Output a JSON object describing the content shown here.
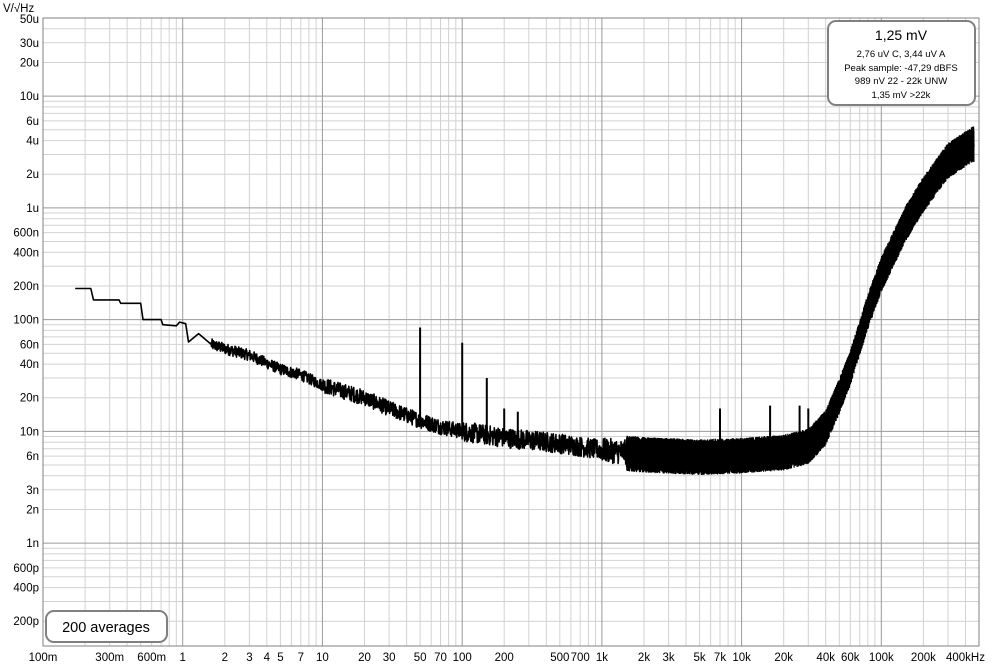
{
  "chart_data": {
    "type": "line",
    "y_unit_label": "V/√Hz",
    "x_scale": "log",
    "y_scale": "log",
    "xlim": [
      0.1,
      500000
    ],
    "ylim": [
      1.2e-10,
      5e-05
    ],
    "grid": true,
    "x_ticks": [
      {
        "v": 0.1,
        "l": "100m"
      },
      {
        "v": 0.3,
        "l": "300m"
      },
      {
        "v": 0.6,
        "l": "600m"
      },
      {
        "v": 1,
        "l": "1"
      },
      {
        "v": 2,
        "l": "2"
      },
      {
        "v": 3,
        "l": "3"
      },
      {
        "v": 4,
        "l": "4"
      },
      {
        "v": 5,
        "l": "5"
      },
      {
        "v": 7,
        "l": "7"
      },
      {
        "v": 10,
        "l": "10"
      },
      {
        "v": 20,
        "l": "20"
      },
      {
        "v": 30,
        "l": "30"
      },
      {
        "v": 50,
        "l": "50"
      },
      {
        "v": 70,
        "l": "70"
      },
      {
        "v": 100,
        "l": "100"
      },
      {
        "v": 200,
        "l": "200"
      },
      {
        "v": 500,
        "l": "500"
      },
      {
        "v": 700,
        "l": "700"
      },
      {
        "v": 1000,
        "l": "1k"
      },
      {
        "v": 2000,
        "l": "2k"
      },
      {
        "v": 3000,
        "l": "3k"
      },
      {
        "v": 5000,
        "l": "5k"
      },
      {
        "v": 7000,
        "l": "7k"
      },
      {
        "v": 10000,
        "l": "10k"
      },
      {
        "v": 20000,
        "l": "20k"
      },
      {
        "v": 40000,
        "l": "40k"
      },
      {
        "v": 60000,
        "l": "60k"
      },
      {
        "v": 100000,
        "l": "100k"
      },
      {
        "v": 200000,
        "l": "200k"
      },
      {
        "v": 400000,
        "l": "400kHz"
      }
    ],
    "y_ticks": [
      {
        "v": 5e-05,
        "l": "50u"
      },
      {
        "v": 3e-05,
        "l": "30u"
      },
      {
        "v": 2e-05,
        "l": "20u"
      },
      {
        "v": 1e-05,
        "l": "10u"
      },
      {
        "v": 6e-06,
        "l": "6u"
      },
      {
        "v": 4e-06,
        "l": "4u"
      },
      {
        "v": 2e-06,
        "l": "2u"
      },
      {
        "v": 1e-06,
        "l": "1u"
      },
      {
        "v": 6e-07,
        "l": "600n"
      },
      {
        "v": 4e-07,
        "l": "400n"
      },
      {
        "v": 2e-07,
        "l": "200n"
      },
      {
        "v": 1e-07,
        "l": "100n"
      },
      {
        "v": 6e-08,
        "l": "60n"
      },
      {
        "v": 4e-08,
        "l": "40n"
      },
      {
        "v": 2e-08,
        "l": "20n"
      },
      {
        "v": 1e-08,
        "l": "10n"
      },
      {
        "v": 6e-09,
        "l": "6n"
      },
      {
        "v": 3e-09,
        "l": "3n"
      },
      {
        "v": 2e-09,
        "l": "2n"
      },
      {
        "v": 1e-09,
        "l": "1n"
      },
      {
        "v": 6e-10,
        "l": "600p"
      },
      {
        "v": 4e-10,
        "l": "400p"
      },
      {
        "v": 2e-10,
        "l": "200p"
      }
    ],
    "series": [
      {
        "values_approx": [
          [
            0.17,
            1.9e-07
          ],
          [
            0.22,
            1.9e-07
          ],
          [
            0.23,
            1.5e-07
          ],
          [
            0.35,
            1.5e-07
          ],
          [
            0.36,
            1.4e-07
          ],
          [
            0.5,
            1.4e-07
          ],
          [
            0.52,
            1e-07
          ],
          [
            0.7,
            1e-07
          ],
          [
            0.72,
            9e-08
          ],
          [
            0.9,
            8.8e-08
          ],
          [
            0.95,
            9.5e-08
          ],
          [
            1.05,
            9.2e-08
          ],
          [
            1.1,
            6.3e-08
          ],
          [
            1.3,
            7.5e-08
          ],
          [
            1.6,
            6e-08
          ],
          [
            2,
            5.5e-08
          ],
          [
            3,
            4.8e-08
          ],
          [
            5,
            3.6e-08
          ],
          [
            7,
            3.2e-08
          ],
          [
            10,
            2.6e-08
          ],
          [
            20,
            2e-08
          ],
          [
            30,
            1.6e-08
          ],
          [
            50,
            1.25e-08
          ],
          [
            70,
            1.1e-08
          ],
          [
            100,
            1e-08
          ],
          [
            200,
            8.8e-09
          ],
          [
            500,
            7.8e-09
          ],
          [
            1000,
            6.8e-09
          ],
          [
            2000,
            6.3e-09
          ],
          [
            5000,
            6e-09
          ],
          [
            10000,
            6.2e-09
          ],
          [
            20000,
            6.6e-09
          ],
          [
            30000,
            7.5e-09
          ],
          [
            40000,
            1.1e-08
          ],
          [
            50000,
            2.1e-08
          ],
          [
            60000,
            3.8e-08
          ],
          [
            80000,
            1.2e-07
          ],
          [
            100000,
            2.6e-07
          ],
          [
            150000,
            7.5e-07
          ],
          [
            200000,
            1.35e-06
          ],
          [
            300000,
            2.7e-06
          ],
          [
            450000,
            3.8e-06
          ]
        ],
        "spikes_approx": [
          [
            50,
            8.5e-08
          ],
          [
            100,
            6.2e-08
          ],
          [
            150,
            3e-08
          ],
          [
            200,
            1.6e-08
          ],
          [
            250,
            1.5e-08
          ],
          [
            7000,
            1.6e-08
          ],
          [
            16000,
            1.7e-08
          ],
          [
            26000,
            1.7e-08
          ],
          [
            30000,
            1.6e-08
          ]
        ]
      }
    ],
    "readout": {
      "main": "1,25 mV",
      "lines": [
        "2,76 uV C, 3,44 uV A",
        "Peak sample: -47,29 dBFS",
        "989 nV 22 - 22k UNW",
        "1,35 mV >22k"
      ]
    },
    "averages_label": "200 averages"
  }
}
